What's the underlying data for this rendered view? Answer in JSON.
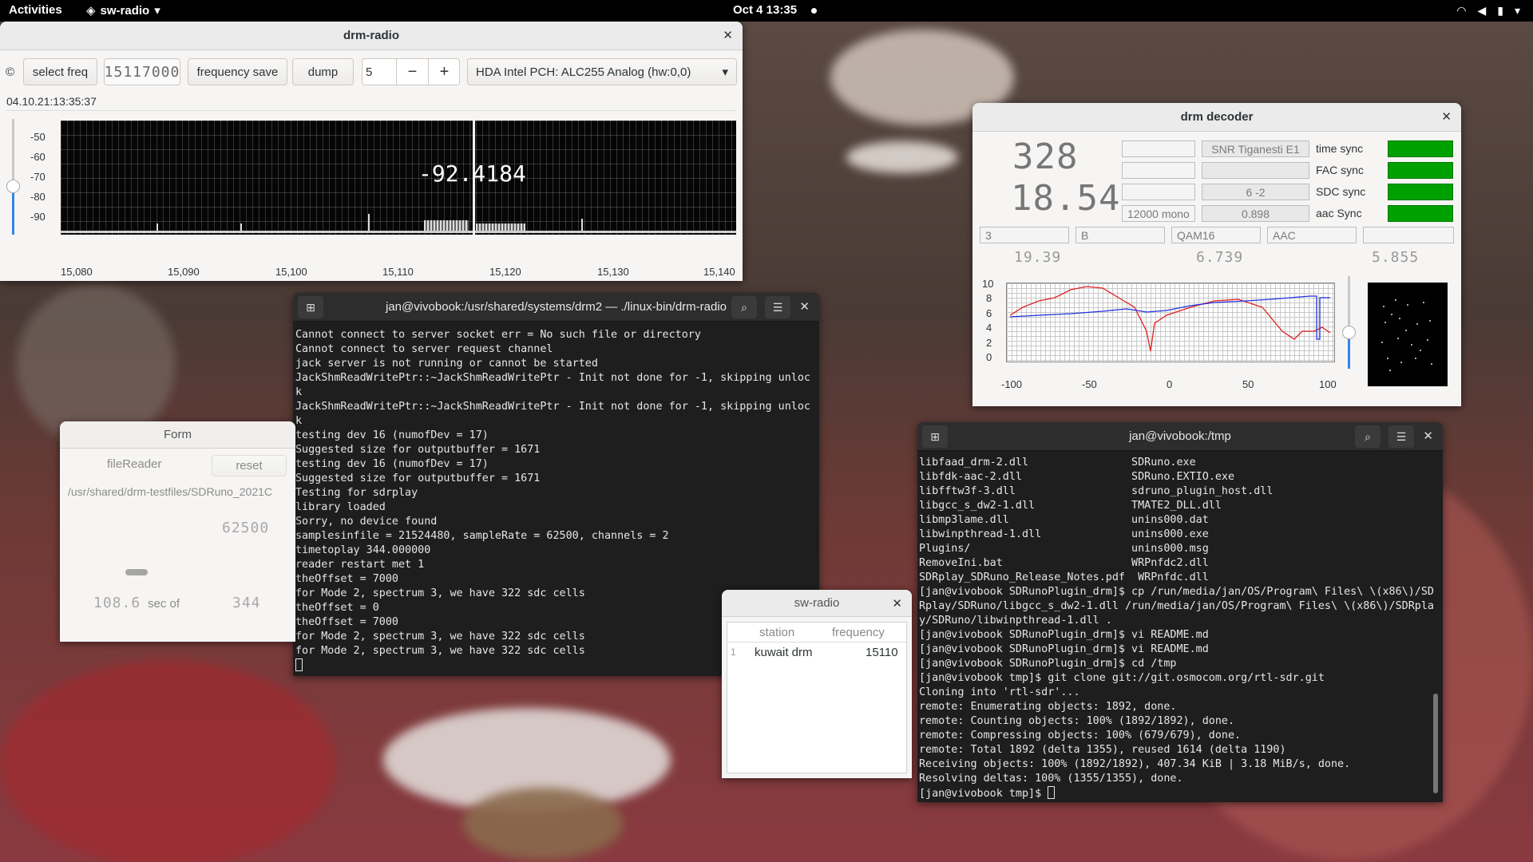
{
  "topbar": {
    "activities": "Activities",
    "app_name": "sw-radio",
    "clock": "Oct 4  13:35"
  },
  "drm_radio": {
    "title": "drm-radio",
    "select_freq": "select freq",
    "freq_display": "15117000",
    "frequency_save": "frequency save",
    "dump": "dump",
    "spin_value": "5",
    "spin_minus": "−",
    "spin_plus": "+",
    "audio_device": "HDA Intel PCH: ALC255 Analog (hw:0,0)",
    "timestamp": "04.10.21:13:35:37",
    "spectrum_value": "-92.4184",
    "y_ticks": [
      "-50",
      "-60",
      "-70",
      "-80",
      "-90"
    ],
    "x_ticks": [
      "15,080",
      "15,090",
      "15,100",
      "15,110",
      "15,120",
      "15,130",
      "15,140"
    ]
  },
  "term1": {
    "title": "jan@vivobook:/usr/shared/systems/drm2 — ./linux-bin/drm-radio",
    "lines": "Cannot connect to server socket err = No such file or directory\nCannot connect to server request channel\njack server is not running or cannot be started\nJackShmReadWritePtr::~JackShmReadWritePtr - Init not done for -1, skipping unloc\nk\nJackShmReadWritePtr::~JackShmReadWritePtr - Init not done for -1, skipping unloc\nk\ntesting dev 16 (numofDev = 17)\nSuggested size for outputbuffer = 1671\ntesting dev 16 (numofDev = 17)\nSuggested size for outputbuffer = 1671\nTesting for sdrplay\nlibrary loaded\nSorry, no device found\nsamplesinfile = 21524480, sampleRate = 62500, channels = 2\ntimetoplay 344.000000\nreader restart met 1\ntheOffset = 7000\nfor Mode 2, spectrum 3, we have 322 sdc cells\ntheOffset = 0\ntheOffset = 7000\nfor Mode 2, spectrum 3, we have 322 sdc cells\nfor Mode 2, spectrum 3, we have 322 sdc cells"
  },
  "term2": {
    "title": "jan@vivobook:/tmp",
    "lines": "libfaad_drm-2.dll                SDRuno.exe\nlibfdk-aac-2.dll                 SDRuno.EXTIO.exe\nlibfftw3f-3.dll                  sdruno_plugin_host.dll\nlibgcc_s_dw2-1.dll               TMATE2_DLL.dll\nlibmp3lame.dll                   unins000.dat\nlibwinpthread-1.dll              unins000.exe\nPlugins/                         unins000.msg\nRemoveIni.bat                    WRPnfdc2.dll\nSDRplay_SDRuno_Release_Notes.pdf  WRPnfdc.dll\n[jan@vivobook SDRunoPlugin_drm]$ cp /run/media/jan/OS/Program\\ Files\\ \\(x86\\)/SD\nRplay/SDRuno/libgcc_s_dw2-1.dll /run/media/jan/OS/Program\\ Files\\ \\(x86\\)/SDRpla\ny/SDRuno/libwinpthread-1.dll .\n[jan@vivobook SDRunoPlugin_drm]$ vi README.md\n[jan@vivobook SDRunoPlugin_drm]$ vi README.md\n[jan@vivobook SDRunoPlugin_drm]$ cd /tmp\n[jan@vivobook tmp]$ git clone git://git.osmocom.org/rtl-sdr.git\nCloning into 'rtl-sdr'...\nremote: Enumerating objects: 1892, done.\nremote: Counting objects: 100% (1892/1892), done.\nremote: Compressing objects: 100% (679/679), done.\nremote: Total 1892 (delta 1355), reused 1614 (delta 1190)\nReceiving objects: 100% (1892/1892), 407.34 KiB | 3.18 MiB/s, done.\nResolving deltas: 100% (1355/1355), done.\n[jan@vivobook tmp]$ "
  },
  "form": {
    "title": "Form",
    "file_reader": "fileReader",
    "reset": "reset",
    "path": "/usr/shared/drm-testfiles/SDRuno_2021C",
    "rate": "62500",
    "position": "108.6",
    "sec_of": "sec of",
    "total": "344"
  },
  "decoder": {
    "title": "drm decoder",
    "big1": "328",
    "big2": "18.54",
    "snr_label": "SNR Tiganesti E1",
    "sdc_vals": "6  -2",
    "audio_mode": "12000 mono",
    "val_0898": "0.898",
    "time_sync": "time sync",
    "fac_sync": "FAC sync",
    "sdc_sync": "SDC sync",
    "aac_sync": "aac Sync",
    "row2": [
      "3",
      "B",
      "QAM16",
      "AAC",
      ""
    ],
    "small1": "19.39",
    "small2": "6.739",
    "small3": "5.855",
    "plot_y": [
      "10",
      "8",
      "6",
      "4",
      "2",
      "0"
    ],
    "plot_x": [
      "-100",
      "-50",
      "0",
      "50",
      "100"
    ],
    "sync_color": "#00a000"
  },
  "sw_radio": {
    "title": "sw-radio",
    "col_station": "station",
    "col_frequency": "frequency",
    "row_index": "1",
    "station": "kuwait drm",
    "frequency": "15110"
  }
}
